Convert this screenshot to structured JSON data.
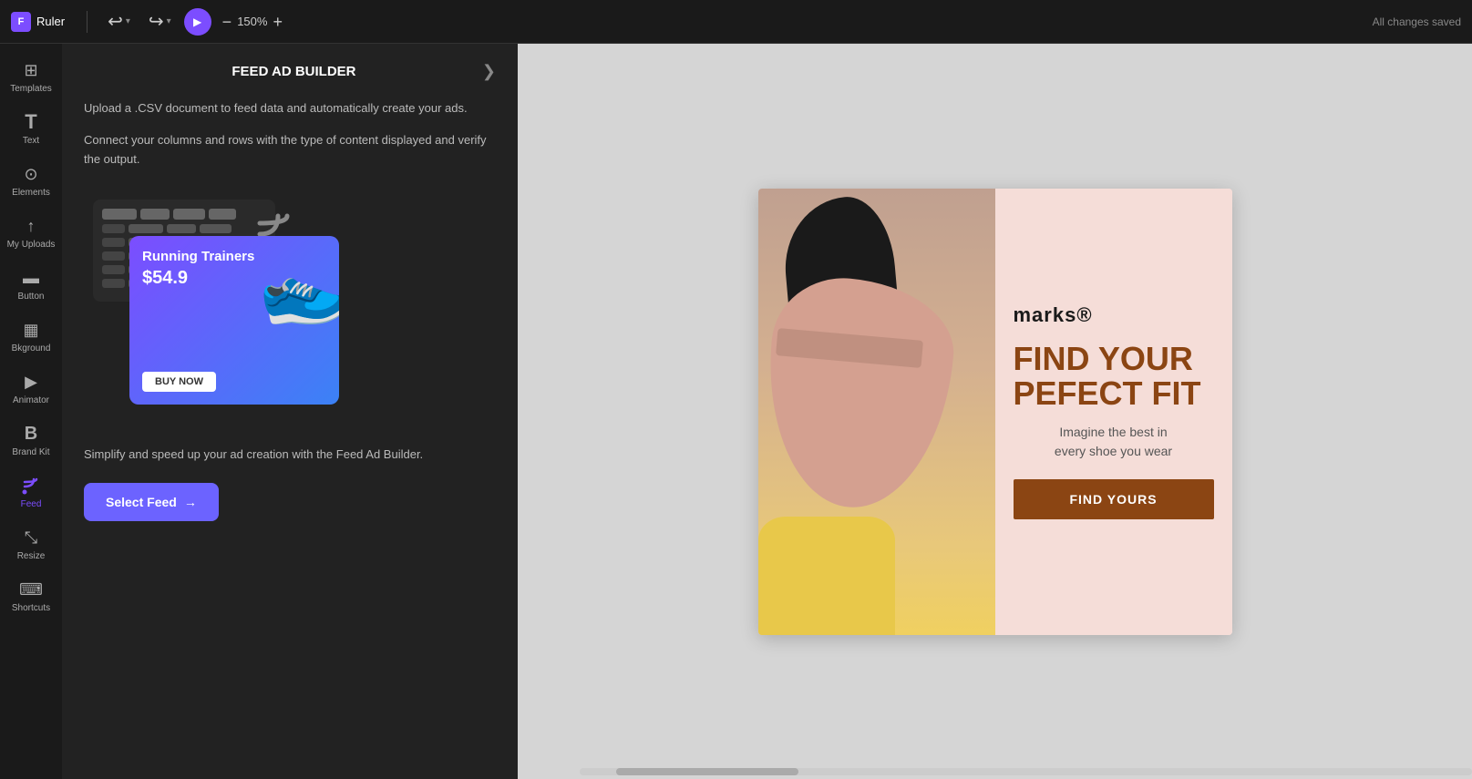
{
  "topbar": {
    "logo_text": "Ruler",
    "undo_label": "↩",
    "redo_label": "↪",
    "play_icon": "▶",
    "zoom_minus": "−",
    "zoom_level": "150%",
    "zoom_plus": "+",
    "status": "All changes saved",
    "collapse_icon": "❯"
  },
  "sidebar": {
    "items": [
      {
        "id": "templates",
        "label": "Templates",
        "icon": "⊞"
      },
      {
        "id": "text",
        "label": "Text",
        "icon": "T"
      },
      {
        "id": "elements",
        "label": "Elements",
        "icon": "⊙"
      },
      {
        "id": "my-uploads",
        "label": "My Uploads",
        "icon": "↑"
      },
      {
        "id": "button",
        "label": "Button",
        "icon": "⬛"
      },
      {
        "id": "background",
        "label": "Bkground",
        "icon": "▦"
      },
      {
        "id": "animator",
        "label": "Animator",
        "icon": "▶"
      },
      {
        "id": "brand-kit",
        "label": "Brand Kit",
        "icon": "B"
      },
      {
        "id": "feed",
        "label": "Feed",
        "icon": "≈",
        "active": true
      },
      {
        "id": "resize",
        "label": "Resize",
        "icon": "⤡"
      },
      {
        "id": "shortcuts",
        "label": "Shortcuts",
        "icon": "⌨"
      }
    ]
  },
  "feed_panel": {
    "title": "FEED AD BUILDER",
    "description1": "Upload a .CSV document to feed data and automatically create your ads.",
    "description2": "Connect your columns and rows with the type of content displayed and verify the output.",
    "description3": "Simplify and speed up your ad creation with the Feed Ad Builder.",
    "select_feed_label": "Select Feed",
    "select_feed_arrow": "→",
    "ad_preview": {
      "title": "Running Trainers",
      "price": "$54.9",
      "button": "BUY NOW"
    }
  },
  "canvas": {
    "brand": "marks®",
    "headline_line1": "FIND YOUR",
    "headline_line2": "PEFECT FIT",
    "subtext": "Imagine the best in\nevery shoe you wear",
    "cta": "FIND YOURS"
  }
}
